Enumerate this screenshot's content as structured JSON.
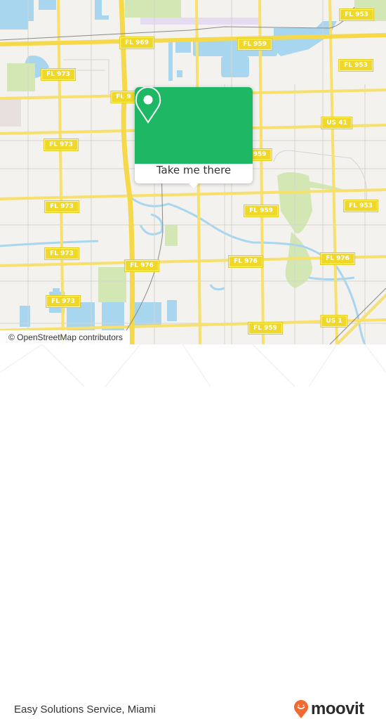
{
  "map": {
    "labels": {
      "water": "#a8d6ee",
      "park": "#d2e7b3",
      "road_major": "#f7e06b",
      "land": "#f3f2ee"
    },
    "shields": [
      {
        "id": "fl953-a",
        "text": "FL 953"
      },
      {
        "id": "fl969",
        "text": "FL 969"
      },
      {
        "id": "fl959-a",
        "text": "FL 959"
      },
      {
        "id": "fl953-b",
        "text": "FL 953"
      },
      {
        "id": "fl973-a",
        "text": "FL 973"
      },
      {
        "id": "fl9-partial",
        "text": "FL 9"
      },
      {
        "id": "us41",
        "text": "US 41"
      },
      {
        "id": "fl973-b",
        "text": "FL 973"
      },
      {
        "id": "fl959-b",
        "text": "959"
      },
      {
        "id": "fl973-c",
        "text": "FL 973"
      },
      {
        "id": "fl959-c",
        "text": "FL 959"
      },
      {
        "id": "fl953-c",
        "text": "FL 953"
      },
      {
        "id": "fl973-d",
        "text": "FL 973"
      },
      {
        "id": "fl976-a",
        "text": "FL 976"
      },
      {
        "id": "fl976-b",
        "text": "FL 976"
      },
      {
        "id": "fl976-c",
        "text": "FL 976"
      },
      {
        "id": "fl973-e",
        "text": "FL 973"
      },
      {
        "id": "fl959-d",
        "text": "FL 959"
      },
      {
        "id": "us1",
        "text": "US 1"
      }
    ],
    "attribution": "© OpenStreetMap contributors"
  },
  "popup": {
    "icon": "map-pin-icon",
    "button_label": "Take me there",
    "accent": "#1eb865"
  },
  "footer": {
    "place_name": "Easy Solutions Service, Miami",
    "brand": "moovit",
    "brand_color": "#f26a30"
  }
}
